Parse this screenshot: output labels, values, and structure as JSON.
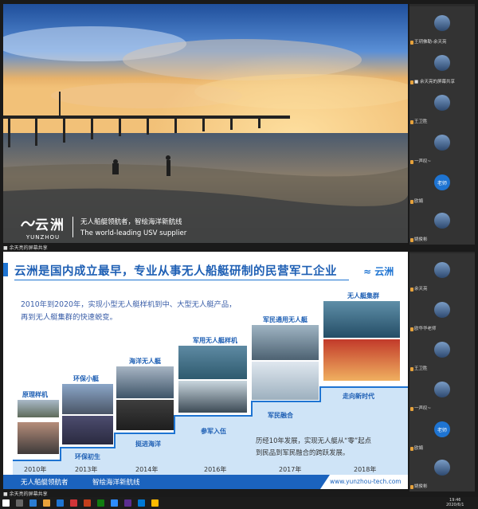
{
  "shared_top": {
    "brand_cn": "云洲",
    "brand_en": "YUNZHOU",
    "slogan_cn": "无人船艇领航者，智绘海洋新航线",
    "slogan_en": "The world-leading USV supplier",
    "caption": "■ 余天亮的屏幕共享"
  },
  "shared_bottom_caption": "■ 余天亮的屏幕共享",
  "participants_top": [
    {
      "name": "王玥佛勒-余天亮",
      "avatar": "photo"
    },
    {
      "name": "■ 余天亮的屏幕共享",
      "avatar": "photo"
    },
    {
      "name": "王卫胜",
      "avatar": "photo"
    },
    {
      "name": "一声叹~",
      "avatar": "photo"
    },
    {
      "name": "欧娟",
      "avatar": "老师"
    },
    {
      "name": "姚俊彬",
      "avatar": "photo"
    }
  ],
  "participants_bottom": [
    {
      "name": "余天亮",
      "avatar": "photo"
    },
    {
      "name": "欧华华老师",
      "avatar": "photo"
    },
    {
      "name": "王卫胜",
      "avatar": "photo"
    },
    {
      "name": "一声叹~",
      "avatar": "photo"
    },
    {
      "name": "欧娟",
      "avatar": "老师"
    },
    {
      "name": "姚俊彬",
      "avatar": "photo"
    }
  ],
  "slide": {
    "title": "云洲是国内成立最早，专业从事无人船艇研制的民营军工企业",
    "logo_text": "云洲",
    "intro_line1": "2010年到2020年，实现小型无人艇样机到中、大型无人艇产品，",
    "intro_line2": "再到无人艇集群的快速蜕变。",
    "stages": [
      {
        "label": "原理样机",
        "year": "2010年",
        "step": "环保初生"
      },
      {
        "label": "环保小艇",
        "year": "2013年",
        "step": "挺进海洋"
      },
      {
        "label": "海洋无人艇",
        "year": "2014年",
        "step": "参军入伍"
      },
      {
        "label": "军用无人艇样机",
        "year": "2016年",
        "step": "军民融合"
      },
      {
        "label": "军民通用无人艇",
        "year": "2017年",
        "step": "走向新时代"
      },
      {
        "label": "无人艇集群",
        "year": "2018年",
        "step": ""
      }
    ],
    "desc_line1": "历经10年发展，实现无人艇从“零”起点",
    "desc_line2": "到民品到军民融合的跨跃发展。",
    "footer_left": "无人船艇领航者",
    "footer_mid": "智绘海洋新航线",
    "url": "www.yunzhou-tech.com"
  },
  "taskbar": {
    "time": "19:46",
    "date": "2020/6/1"
  },
  "colors": {
    "accent": "#1e74d2",
    "title": "#1e5fb4",
    "footer": "#1b63be"
  }
}
